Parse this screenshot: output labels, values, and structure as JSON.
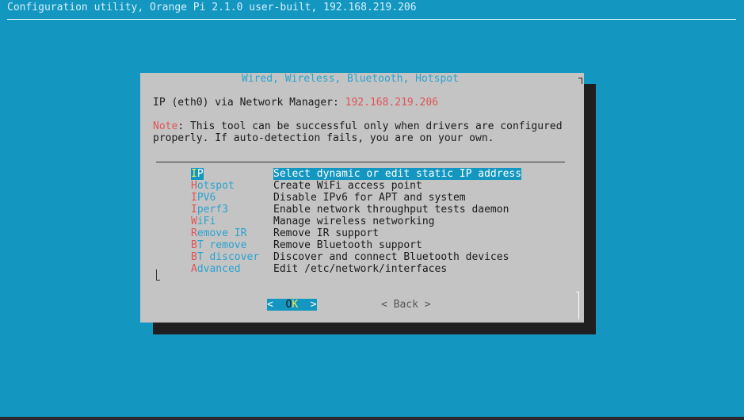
{
  "backtitle": "Configuration utility, Orange Pi 2.1.0 user-built, 192.168.219.206",
  "dialog": {
    "title": "Wired, Wireless, Bluetooth, Hotspot",
    "ip_label": "IP (eth0) via Network Manager: ",
    "ip_value": "192.168.219.206",
    "note_label": "Note",
    "note_line1": ": This tool can be successful only when drivers are configured",
    "note_line2": "properly. If auto-detection fails, you are on your own."
  },
  "menu": {
    "selected_index": 0,
    "items": [
      {
        "hot": "I",
        "rest": "P",
        "desc": "Select dynamic or edit static IP address"
      },
      {
        "hot": "H",
        "rest": "otspot",
        "desc": "Create WiFi access point"
      },
      {
        "hot": "I",
        "rest": "PV6",
        "desc": "Disable IPv6 for APT and system"
      },
      {
        "hot": "I",
        "rest": "perf3",
        "desc": "Enable network throughput tests daemon"
      },
      {
        "hot": "W",
        "rest": "iFi",
        "desc": "Manage wireless networking"
      },
      {
        "hot": "R",
        "rest": "emove IR",
        "desc": "Remove IR support"
      },
      {
        "hot": "B",
        "rest": "T remove",
        "desc": "Remove Bluetooth support"
      },
      {
        "hot": "B",
        "rest": "T discover",
        "desc": "Discover and connect Bluetooth devices"
      },
      {
        "hot": "A",
        "rest": "dvanced",
        "desc": "Edit /etc/network/interfaces"
      }
    ]
  },
  "buttons": {
    "ok_left": "<  ",
    "ok_first": "O",
    "ok_hot": "K",
    "ok_right": "  >",
    "back": "< Back >"
  },
  "colors": {
    "background": "#1396c0",
    "dialog": "#c4c4c4",
    "hotkey": "#e05454",
    "highlight_text": "#f5f05a"
  }
}
